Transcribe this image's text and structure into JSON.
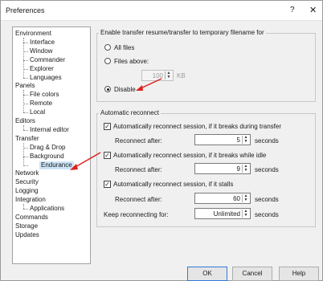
{
  "window": {
    "title": "Preferences",
    "help_label": "?",
    "close_label": "✕"
  },
  "tree": [
    {
      "label": "Environment",
      "level": 0
    },
    {
      "label": "Interface",
      "level": 1
    },
    {
      "label": "Window",
      "level": 1
    },
    {
      "label": "Commander",
      "level": 1
    },
    {
      "label": "Explorer",
      "level": 1
    },
    {
      "label": "Languages",
      "level": 1
    },
    {
      "label": "Panels",
      "level": 0
    },
    {
      "label": "File colors",
      "level": 1
    },
    {
      "label": "Remote",
      "level": 1
    },
    {
      "label": "Local",
      "level": 1
    },
    {
      "label": "Editors",
      "level": 0
    },
    {
      "label": "Internal editor",
      "level": 1
    },
    {
      "label": "Transfer",
      "level": 0
    },
    {
      "label": "Drag & Drop",
      "level": 1
    },
    {
      "label": "Background",
      "level": 1
    },
    {
      "label": "Endurance",
      "level": 1,
      "selected": true
    },
    {
      "label": "Network",
      "level": 0
    },
    {
      "label": "Security",
      "level": 0
    },
    {
      "label": "Logging",
      "level": 0
    },
    {
      "label": "Integration",
      "level": 0
    },
    {
      "label": "Applications",
      "level": 1
    },
    {
      "label": "Commands",
      "level": 0
    },
    {
      "label": "Storage",
      "level": 0
    },
    {
      "label": "Updates",
      "level": 0
    }
  ],
  "resume": {
    "heading": "Enable transfer resume/transfer to temporary filename for",
    "all_files": "All files",
    "files_above": "Files above:",
    "threshold_value": "100",
    "threshold_unit": "KB",
    "disable": "Disable",
    "selected": "disable"
  },
  "reconnect": {
    "heading": "Automatic reconnect",
    "during_transfer": {
      "label": "Automatically reconnect session, if it breaks during transfer",
      "checked": true,
      "after_label": "Reconnect after:",
      "value": "5",
      "unit": "seconds"
    },
    "while_idle": {
      "label": "Automatically reconnect session, if it breaks while idle",
      "checked": true,
      "after_label": "Reconnect after:",
      "value": "9",
      "unit": "seconds"
    },
    "stalls": {
      "label": "Automatically reconnect session, if it stalls",
      "checked": true,
      "after_label": "Reconnect after:",
      "value": "60",
      "unit": "seconds"
    },
    "keep_label": "Keep reconnecting for:",
    "keep_value": "Unlimited",
    "keep_unit": "seconds"
  },
  "buttons": {
    "ok": "OK",
    "cancel": "Cancel",
    "help": "Help"
  },
  "colors": {
    "annotation_arrow": "#e0201b",
    "selection": "#cce4f7"
  },
  "icons": {
    "spin": "up-down-arrows-icon",
    "check": "checkmark-icon"
  }
}
